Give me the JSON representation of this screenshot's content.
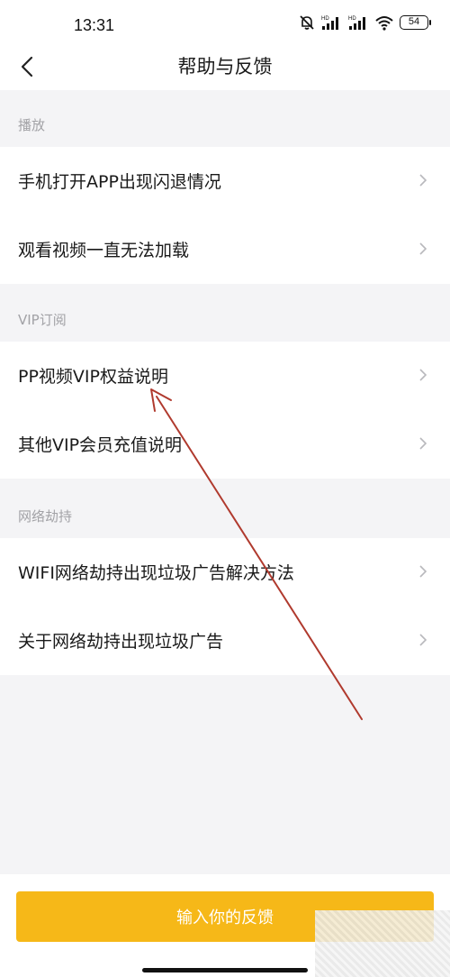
{
  "status_bar": {
    "time": "13:31",
    "battery": "54"
  },
  "nav": {
    "title": "帮助与反馈"
  },
  "sections": [
    {
      "header": "播放",
      "items": [
        {
          "label": "手机打开APP出现闪退情况"
        },
        {
          "label": "观看视频一直无法加载"
        }
      ]
    },
    {
      "header": "VIP订阅",
      "items": [
        {
          "label": "PP视频VIP权益说明"
        },
        {
          "label": "其他VIP会员充值说明"
        }
      ]
    },
    {
      "header": "网络劫持",
      "items": [
        {
          "label": "WIFI网络劫持出现垃圾广告解决方法"
        },
        {
          "label": "关于网络劫持出现垃圾广告"
        }
      ]
    }
  ],
  "footer": {
    "feedback_label": "输入你的反馈"
  },
  "colors": {
    "accent": "#f6b818",
    "background": "#f4f4f6",
    "section_header": "#a2a2a6",
    "annotation_arrow": "#b03a2e"
  },
  "icons": {
    "back": "chevron-left-icon",
    "row": "chevron-right-icon",
    "mute": "bell-off-icon",
    "signal": "signal-icon",
    "wifi": "wifi-icon",
    "battery": "battery-icon"
  }
}
